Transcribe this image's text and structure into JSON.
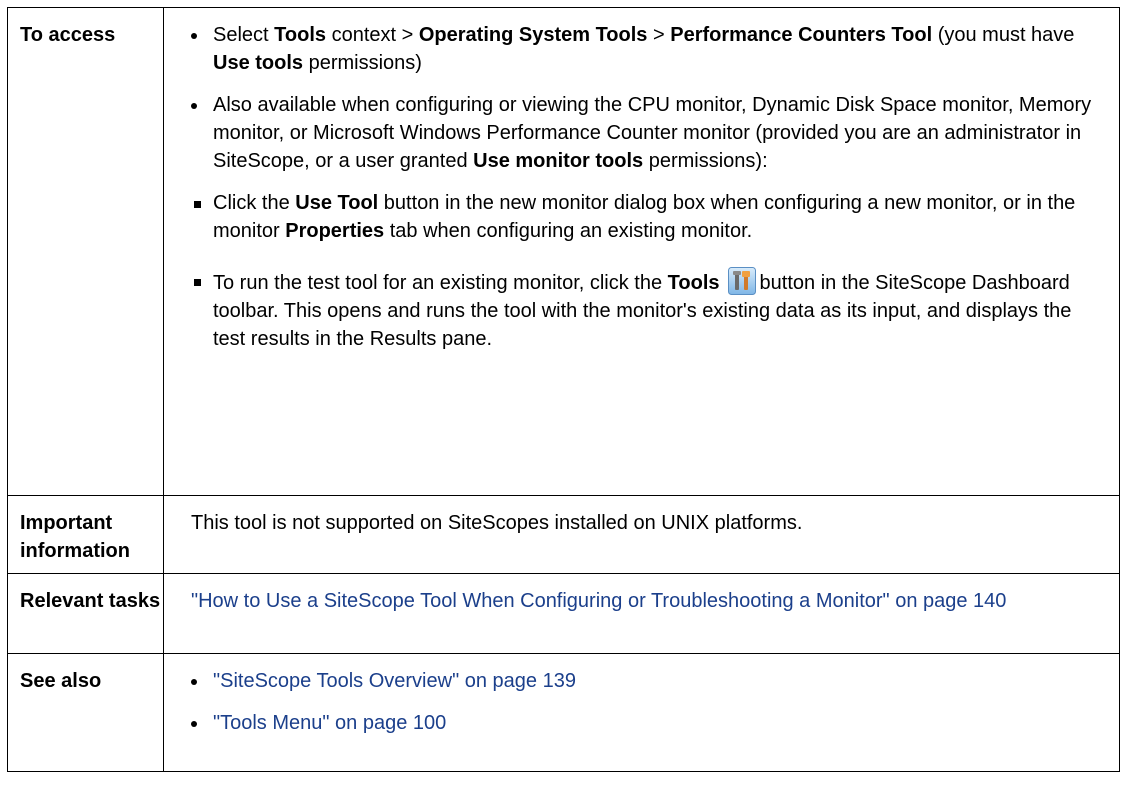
{
  "rows": {
    "access": {
      "label": "To access",
      "item1": {
        "t1": "Select ",
        "b1": "Tools",
        "t2": " context > ",
        "b2": "Operating System Tools",
        "t3": " > ",
        "b3": "Performance Counters Tool",
        "t4": " (you must have ",
        "b4": "Use tools",
        "t5": " permissions)"
      },
      "item2": {
        "t1": "Also available when configuring or viewing the CPU monitor, Dynamic Disk Space monitor, Memory monitor, or Microsoft Windows Performance Counter monitor (provided you are an administrator in SiteScope, or a user granted ",
        "b1": "Use monitor tools",
        "t2": " permissions):"
      },
      "sub1": {
        "t1": "Click the ",
        "b1": "Use Tool",
        "t2": " button in the new monitor dialog box when configuring a new monitor, or in the monitor ",
        "b2": "Properties",
        "t3": " tab when configuring an existing monitor."
      },
      "sub2": {
        "t1": "To run the test tool for an existing monitor, click the ",
        "b1": "Tools",
        "icon": "tools-icon",
        "t2": "button in the SiteScope Dashboard toolbar. This opens and runs the tool with the monitor's existing data as its input, and displays the test results in the Results pane."
      }
    },
    "important": {
      "label": "Important information",
      "text": "This tool is not supported on SiteScopes installed on UNIX platforms."
    },
    "relevant": {
      "label": "Relevant tasks",
      "link": "\"How to Use a SiteScope Tool When Configuring or Troubleshooting a Monitor\" on page 140"
    },
    "see_also": {
      "label": "See also",
      "links": [
        "\"SiteScope Tools Overview\" on page 139",
        "\"Tools Menu\" on page 100"
      ]
    }
  },
  "colors": {
    "link": "#1b3f8b",
    "border": "#000000"
  }
}
